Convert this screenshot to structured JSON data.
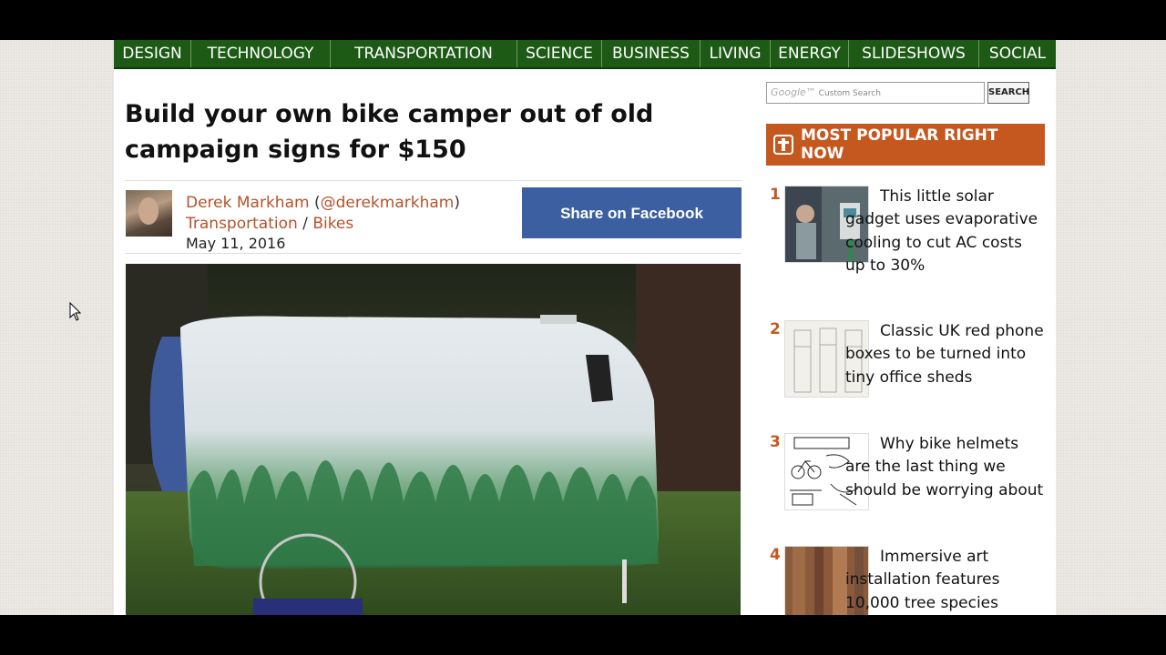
{
  "nav": [
    {
      "label": "DESIGN"
    },
    {
      "label": "TECHNOLOGY"
    },
    {
      "label": "TRANSPORTATION"
    },
    {
      "label": "SCIENCE"
    },
    {
      "label": "BUSINESS"
    },
    {
      "label": "LIVING"
    },
    {
      "label": "ENERGY"
    },
    {
      "label": "SLIDESHOWS"
    },
    {
      "label": "SOCIAL"
    }
  ],
  "article": {
    "title": "Build your own bike camper out of old campaign signs for $150",
    "author_name": "Derek Markham",
    "author_paren_open": " (",
    "author_handle": "@derekmarkham",
    "author_paren_close": ")",
    "category": "Transportation",
    "category_sep": " / ",
    "subcategory": "Bikes",
    "date": "May 11, 2016",
    "share_label": "Share on Facebook"
  },
  "search": {
    "brand": "Google™",
    "placeholder": "Custom Search",
    "button_label": "SEARCH"
  },
  "popular": {
    "heading": "MOST POPULAR RIGHT NOW",
    "items": [
      {
        "num": "1",
        "title": "This little solar gadget uses evaporative cooling to cut AC costs up to 30%"
      },
      {
        "num": "2",
        "title": "Classic UK red phone boxes to be turned into tiny office sheds"
      },
      {
        "num": "3",
        "title": "Why bike helmets are the last thing we should be worrying about"
      },
      {
        "num": "4",
        "title": "Immersive art installation features 10,000 tree species"
      }
    ]
  },
  "colors": {
    "nav_bg": "#1d5a16",
    "accent": "#c4581f",
    "link": "#b5522a",
    "facebook": "#3b5fa0"
  },
  "icons": [
    "star-icon",
    "cursor-icon"
  ]
}
